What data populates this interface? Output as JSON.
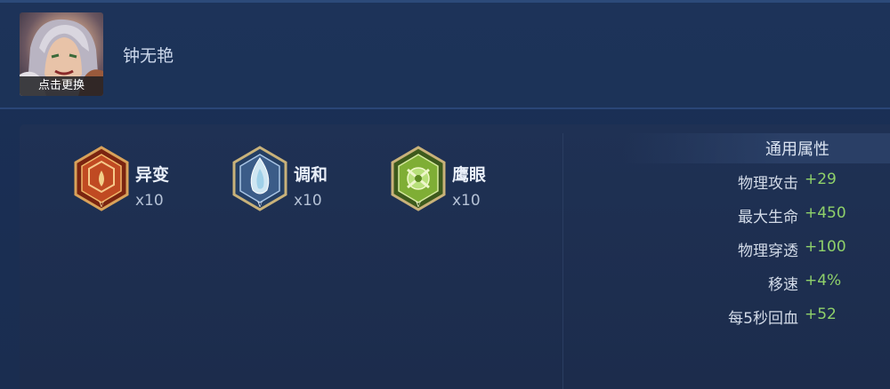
{
  "header": {
    "avatar_button": "点击更换",
    "hero_name": "钟无艳"
  },
  "runes": [
    {
      "name": "异变",
      "count": "x10",
      "icon": "red-rune-icon",
      "color": "#c04a22"
    },
    {
      "name": "调和",
      "count": "x10",
      "icon": "blue-rune-icon",
      "color": "#5d87b8"
    },
    {
      "name": "鹰眼",
      "count": "x10",
      "icon": "green-rune-icon",
      "color": "#7fae35"
    }
  ],
  "attributes": {
    "title": "通用属性",
    "items": [
      {
        "label": "物理攻击",
        "value": "+29"
      },
      {
        "label": "最大生命",
        "value": "+450"
      },
      {
        "label": "物理穿透",
        "value": "+100"
      },
      {
        "label": "移速",
        "value": "+4%"
      },
      {
        "label": "每5秒回血",
        "value": "+52"
      }
    ]
  },
  "colors": {
    "value_green": "#8fd16a",
    "background": "#1a2d50"
  }
}
